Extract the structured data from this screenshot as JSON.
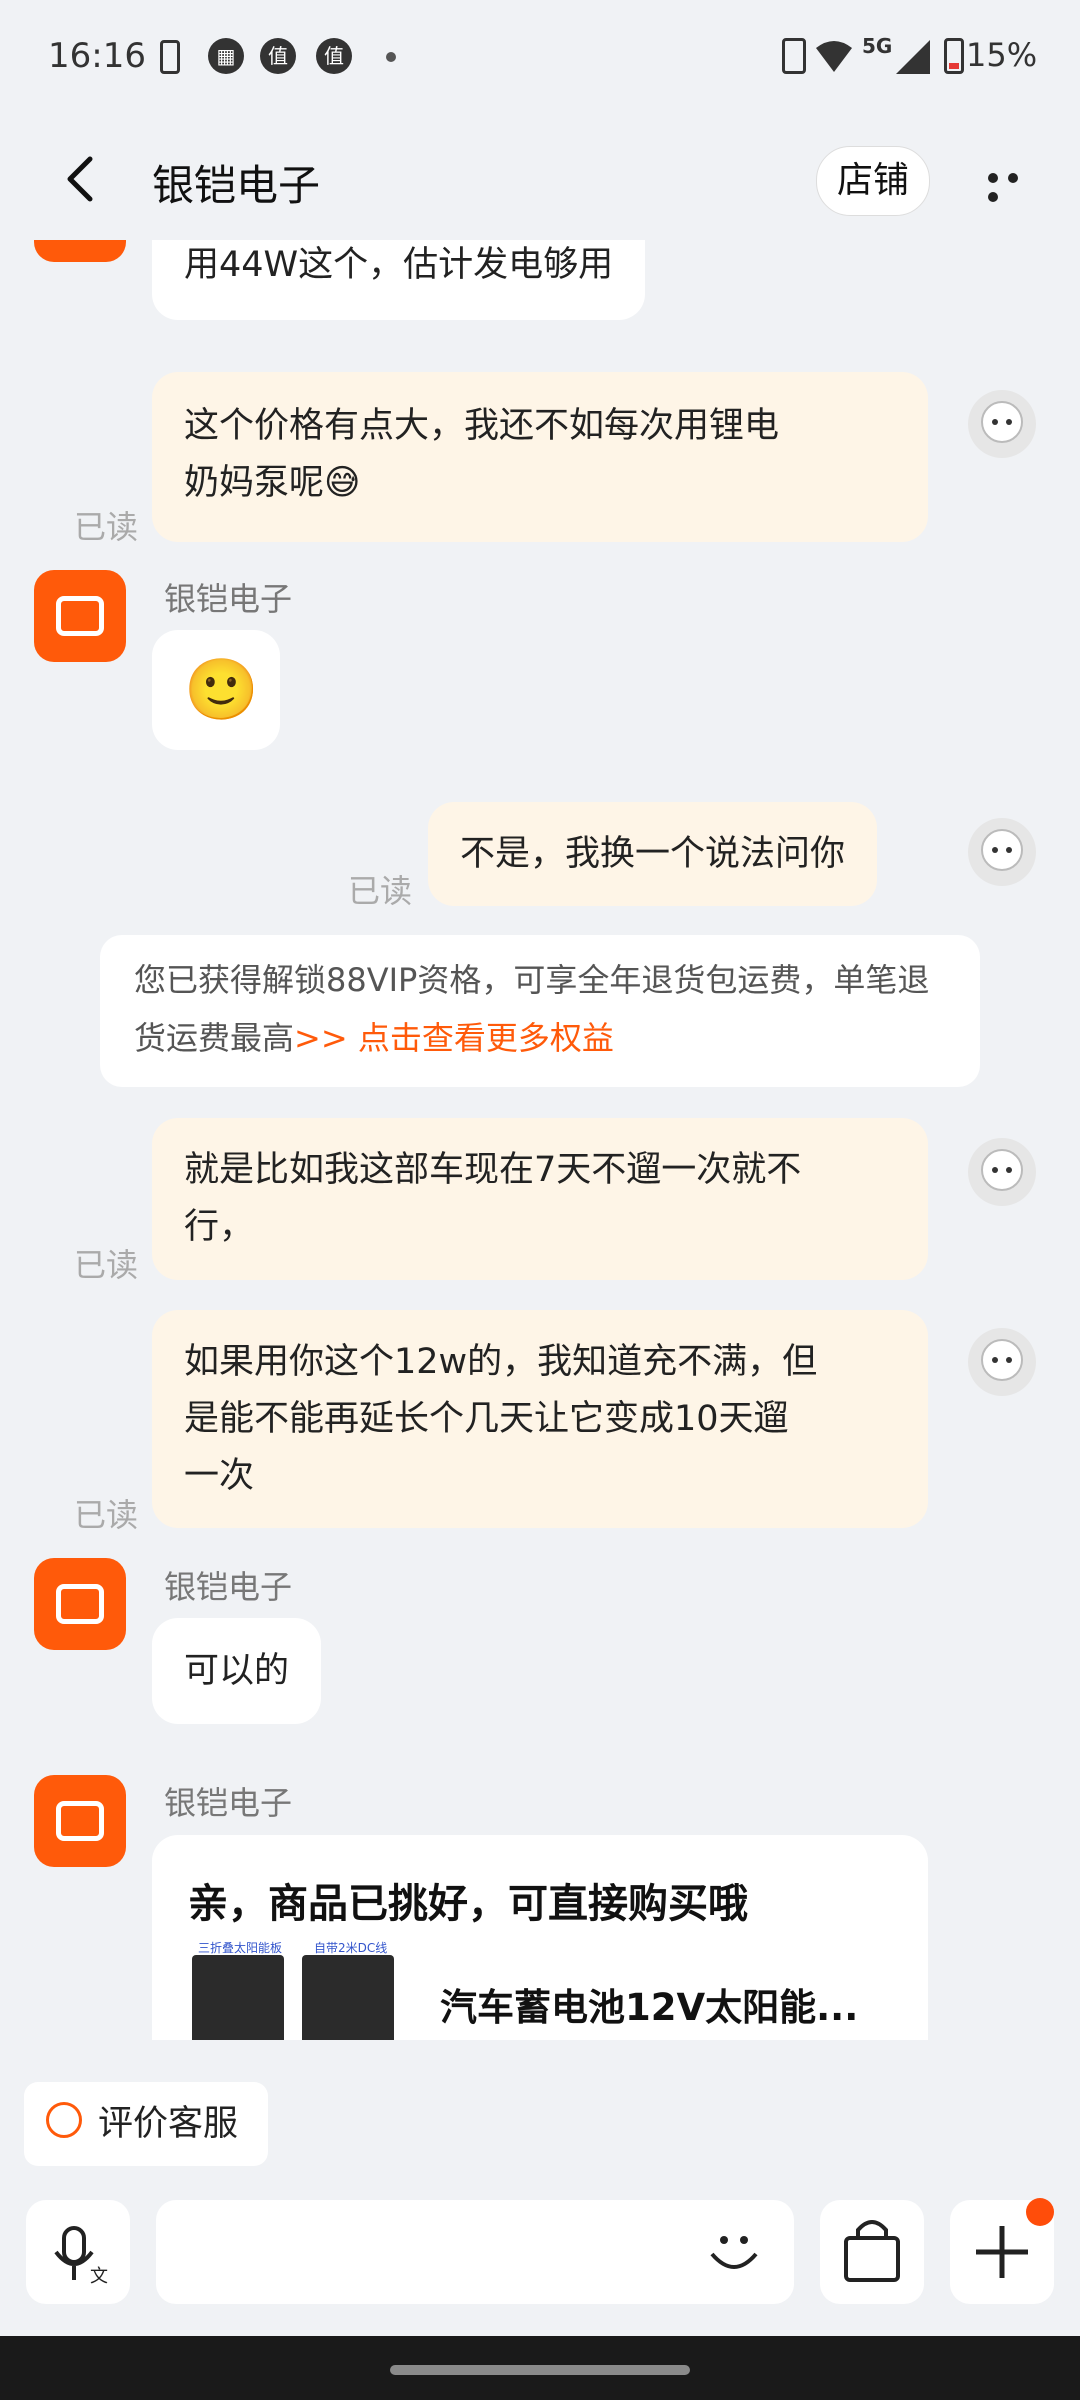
{
  "status_bar": {
    "time": "16:16",
    "icons": [
      "battery-saver-icon",
      "calendar-icon",
      "zhi-app-icon",
      "zhi-app-icon"
    ],
    "network": "5G",
    "battery": "15%"
  },
  "header": {
    "title": "银铠电子",
    "shop_button": "店铺"
  },
  "chat": {
    "read_label": "已读",
    "shop_name": "银铠电子",
    "messages": [
      {
        "from": "shop",
        "text": "用44W这个，估计发电够用"
      },
      {
        "from": "me",
        "lines": [
          "这个价格有点大，我还不如每次用锂电",
          "奶妈泵呢😅"
        ],
        "read": true
      },
      {
        "from": "shop",
        "text": "🙂"
      },
      {
        "from": "me",
        "lines": [
          "不是，我换一个说法问你"
        ],
        "read": true
      },
      {
        "from": "me",
        "lines": [
          "就是比如我这部车现在7天不遛一次就不",
          "行，"
        ],
        "read": true
      },
      {
        "from": "me",
        "lines": [
          "如果用你这个12w的，我知道充不满，但",
          "是能不能再延长个几天让它变成10天遛",
          "一次"
        ],
        "read": true
      },
      {
        "from": "shop",
        "text": "可以的"
      }
    ],
    "notice": {
      "text": "您已获得解锁88VIP资格，可享全年退货包运费，单笔退货运费最高",
      "link": ">> 点击查看更多权益"
    },
    "product_card": {
      "title": "亲，商品已挑好，可直接购买哦",
      "thumb1_caption": "三折叠太阳能板",
      "thumb2_caption": "自带2米DC线",
      "product_name": "汽车蓄电池12V太阳能..."
    }
  },
  "bottom": {
    "evaluate_button": "评价客服",
    "accent": "#ff5a0a"
  }
}
